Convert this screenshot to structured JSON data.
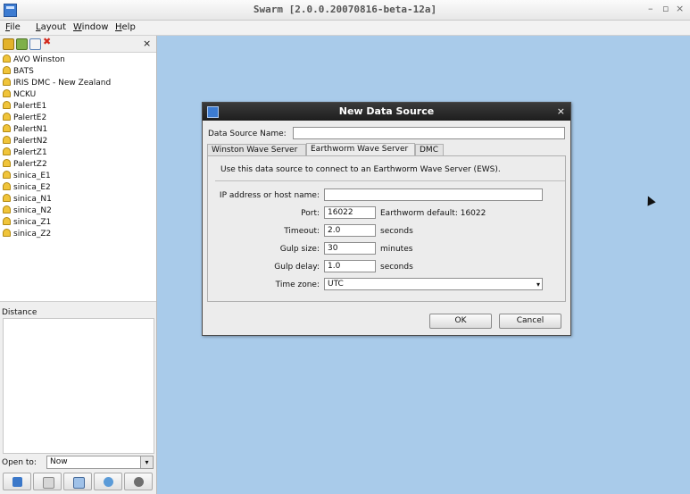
{
  "window": {
    "title": "Swarm [2.0.0.20070816-beta-12a]",
    "controls": {
      "minimize": "–",
      "maximize": "▫",
      "close": "×"
    }
  },
  "menubar": {
    "items": [
      "File",
      "Layout",
      "Window",
      "Help"
    ]
  },
  "left_panel": {
    "toolbar_close": "×",
    "tree_items": [
      "AVO Winston",
      "BATS",
      "IRIS DMC - New Zealand",
      "NCKU",
      "PalertE1",
      "PalertE2",
      "PalertN1",
      "PalertN2",
      "PalertZ1",
      "PalertZ2",
      "sinica_E1",
      "sinica_E2",
      "sinica_N1",
      "sinica_N2",
      "sinica_Z1",
      "sinica_Z2"
    ],
    "distance_label": "Distance",
    "open_to_label": "Open to:",
    "open_to_value": "Now",
    "dropdown_arrow": "▾"
  },
  "dialog": {
    "title": "New Data Source",
    "close": "×",
    "data_source_name_label": "Data Source Name:",
    "data_source_name_value": "",
    "tabs": [
      "Winston Wave Server",
      "Earthworm Wave Server",
      "DMC"
    ],
    "active_tab": "Earthworm Wave Server",
    "description": "Use this data source to connect to an Earthworm Wave Server (EWS).",
    "fields": {
      "host": {
        "label": "IP address or host name:",
        "value": ""
      },
      "port": {
        "label": "Port:",
        "value": "16022",
        "note": "Earthworm default: 16022"
      },
      "timeout": {
        "label": "Timeout:",
        "value": "2.0",
        "unit": "seconds"
      },
      "gulp_size": {
        "label": "Gulp size:",
        "value": "30",
        "unit": "minutes"
      },
      "gulp_delay": {
        "label": "Gulp delay:",
        "value": "1.0",
        "unit": "seconds"
      },
      "time_zone": {
        "label": "Time zone:",
        "value": "UTC"
      }
    },
    "buttons": {
      "ok": "OK",
      "cancel": "Cancel"
    }
  },
  "colors": {
    "desktop": "#a9cbea",
    "dialog_title_bg": "#262626",
    "panel_bg": "#efefef"
  }
}
